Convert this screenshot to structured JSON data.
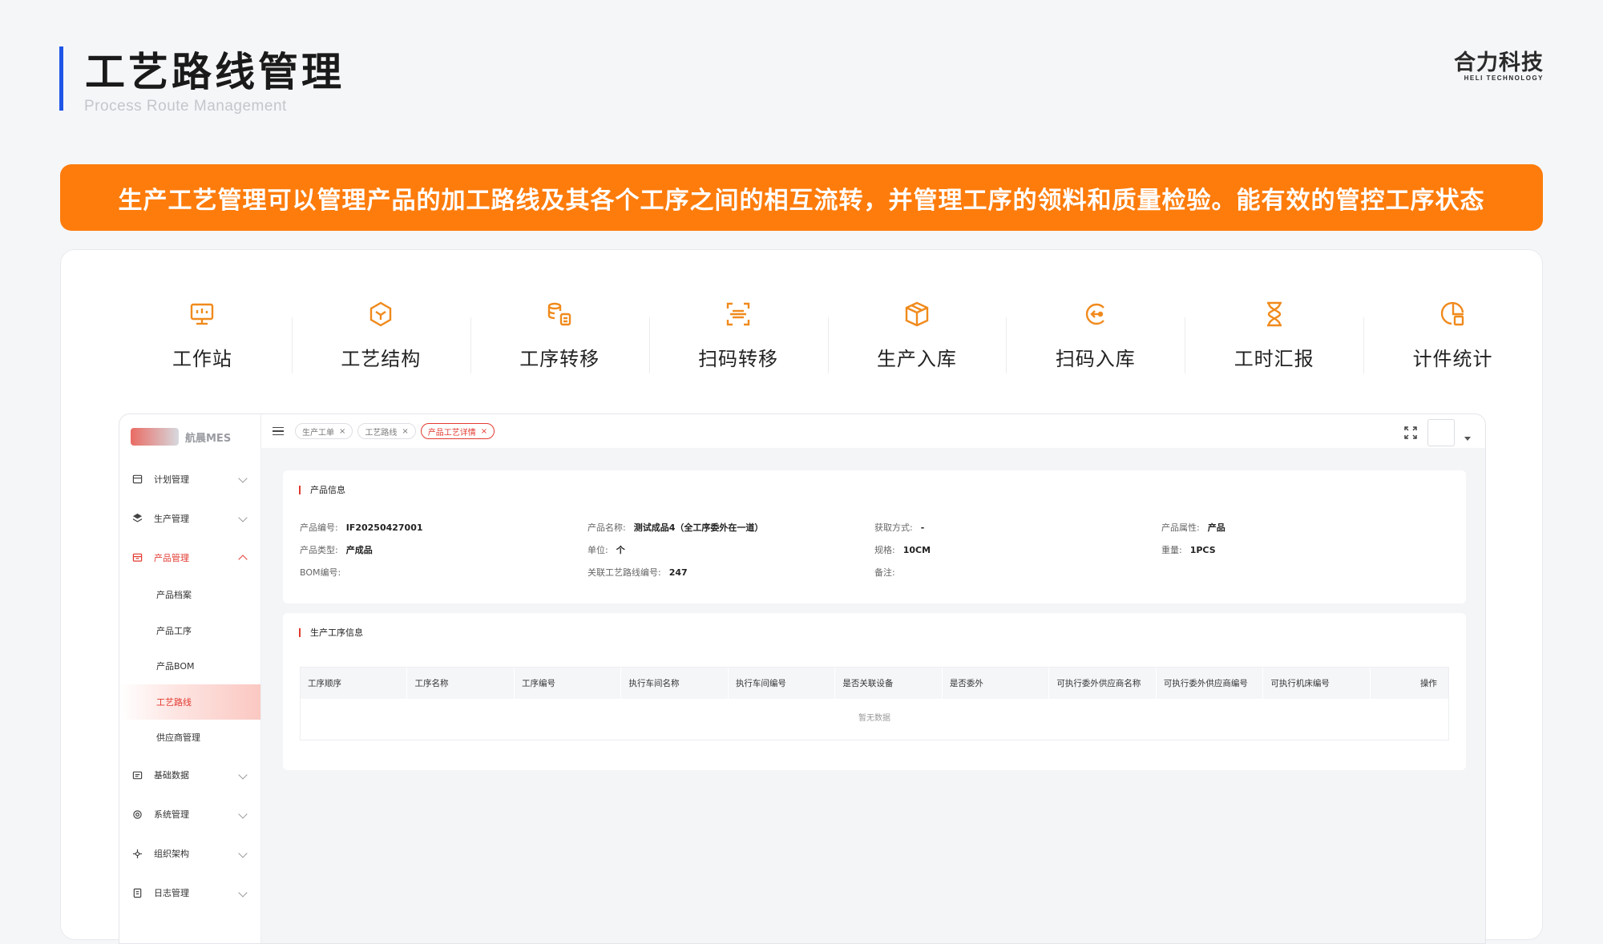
{
  "header": {
    "title": "工艺路线管理",
    "subtitle": "Process Route Management",
    "brand_cn": "合力科技",
    "brand_en": "HELI TECHNOLOGY"
  },
  "banner": {
    "text": "生产工艺管理可以管理产品的加工路线及其各个工序之间的相互流转，并管理工序的领料和质量检验。能有效的管控工序状态"
  },
  "features": [
    {
      "label": "工作站",
      "icon": "monitor-icon"
    },
    {
      "label": "工艺结构",
      "icon": "cube-icon"
    },
    {
      "label": "工序转移",
      "icon": "database-transfer-icon"
    },
    {
      "label": "扫码转移",
      "icon": "scan-icon"
    },
    {
      "label": "生产入库",
      "icon": "box-icon"
    },
    {
      "label": "扫码入库",
      "icon": "scan-in-icon"
    },
    {
      "label": "工时汇报",
      "icon": "hourglass-icon"
    },
    {
      "label": "计件统计",
      "icon": "chart-pie-icon"
    }
  ],
  "app": {
    "sidebar": {
      "logo_text": "航晨MES",
      "items": [
        {
          "label": "计划管理"
        },
        {
          "label": "生产管理"
        },
        {
          "label": "产品管理"
        },
        {
          "label": "基础数据"
        },
        {
          "label": "系统管理"
        },
        {
          "label": "组织架构"
        },
        {
          "label": "日志管理"
        }
      ],
      "sub_items": [
        {
          "label": "产品档案"
        },
        {
          "label": "产品工序"
        },
        {
          "label": "产品BOM"
        },
        {
          "label": "工艺路线"
        },
        {
          "label": "供应商管理"
        }
      ]
    },
    "tabs": [
      {
        "label": "生产工单"
      },
      {
        "label": "工艺路线"
      },
      {
        "label": "产品工艺详情"
      }
    ],
    "product_info": {
      "title": "产品信息",
      "code_label": "产品编号:",
      "code_value": "IF20250427001",
      "name_label": "产品名称:",
      "name_value": "测试成品4（全工序委外在一道）",
      "acquire_label": "获取方式:",
      "acquire_value": "-",
      "attr_label": "产品属性:",
      "attr_value": "产品",
      "type_label": "产品类型:",
      "type_value": "产成品",
      "unit_label": "单位:",
      "unit_value": "个",
      "spec_label": "规格:",
      "spec_value": "10CM",
      "weight_label": "重量:",
      "weight_value": "1PCS",
      "bom_label": "BOM编号:",
      "route_label": "关联工艺路线编号:",
      "route_value": "247",
      "remark_label": "备注:"
    },
    "process_info": {
      "title": "生产工序信息",
      "columns": [
        "工序顺序",
        "工序名称",
        "工序编号",
        "执行车间名称",
        "执行车间编号",
        "是否关联设备",
        "是否委外",
        "可执行委外供应商名称",
        "可执行委外供应商编号",
        "可执行机床编号",
        "操作"
      ],
      "empty_text": "暂无数据"
    }
  },
  "colors": {
    "accent_blue": "#1f56e8",
    "banner_orange": "#fe7c0c",
    "icon_orange": "#f08a1c",
    "active_red": "#e23a30"
  }
}
